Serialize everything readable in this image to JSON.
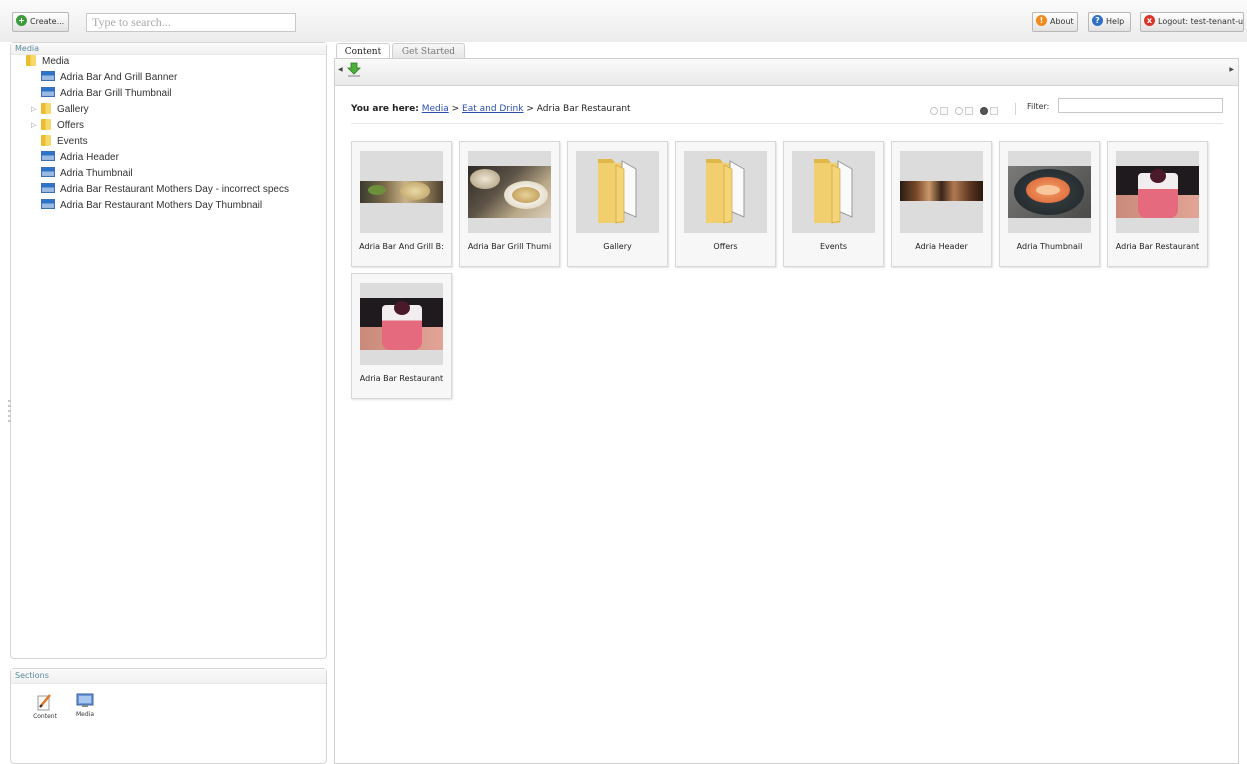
{
  "topbar": {
    "create_label": "Create...",
    "search_placeholder": "Type to search...",
    "about_label": "About",
    "help_label": "Help",
    "logout_label": "Logout: test-tenant-user"
  },
  "media_panel": {
    "title": "Media",
    "tree": [
      {
        "label": "Media",
        "type": "folder-root"
      },
      {
        "label": "Adria Bar And Grill Banner",
        "type": "image"
      },
      {
        "label": "Adria Bar Grill Thumbnail",
        "type": "image"
      },
      {
        "label": "Gallery",
        "type": "folder",
        "expandable": true
      },
      {
        "label": "Offers",
        "type": "folder",
        "expandable": true
      },
      {
        "label": "Events",
        "type": "folder"
      },
      {
        "label": "Adria Header",
        "type": "image"
      },
      {
        "label": "Adria Thumbnail",
        "type": "image"
      },
      {
        "label": "Adria Bar Restaurant Mothers Day - incorrect specs",
        "type": "image"
      },
      {
        "label": "Adria Bar Restaurant Mothers Day Thumbnail",
        "type": "image"
      }
    ]
  },
  "sections_panel": {
    "title": "Sections",
    "items": [
      {
        "label": "Content",
        "icon": "pencil-icon"
      },
      {
        "label": "Media",
        "icon": "monitor-icon"
      }
    ]
  },
  "tabs": [
    {
      "label": "Content",
      "active": true
    },
    {
      "label": "Get Started",
      "active": false
    }
  ],
  "breadcrumb": {
    "prefix": "You are here:",
    "links": [
      "Media",
      "Eat and Drink"
    ],
    "current": "Adria Bar Restaurant",
    "separator": ">"
  },
  "filter": {
    "label": "Filter:",
    "value": ""
  },
  "tiles": [
    {
      "label": "Adria Bar And Grill B:",
      "kind": "banner-food"
    },
    {
      "label": "Adria Bar Grill Thumi",
      "kind": "photo-food"
    },
    {
      "label": "Gallery",
      "kind": "folder"
    },
    {
      "label": "Offers",
      "kind": "folder"
    },
    {
      "label": "Events",
      "kind": "folder"
    },
    {
      "label": "Adria Header",
      "kind": "banner-dark"
    },
    {
      "label": "Adria Thumbnail",
      "kind": "photo-shrimp"
    },
    {
      "label": "Adria Bar Restaurant",
      "kind": "photo-dessert"
    },
    {
      "label": "Adria Bar Restaurant",
      "kind": "photo-dessert"
    }
  ],
  "colors": {
    "link": "#2a4fb0",
    "panel_title": "#5a8a9c",
    "about_icon": "#f08a1c",
    "help_icon": "#2f6fc4",
    "logout_icon": "#d9352b",
    "create_icon": "#3c9a3c"
  }
}
